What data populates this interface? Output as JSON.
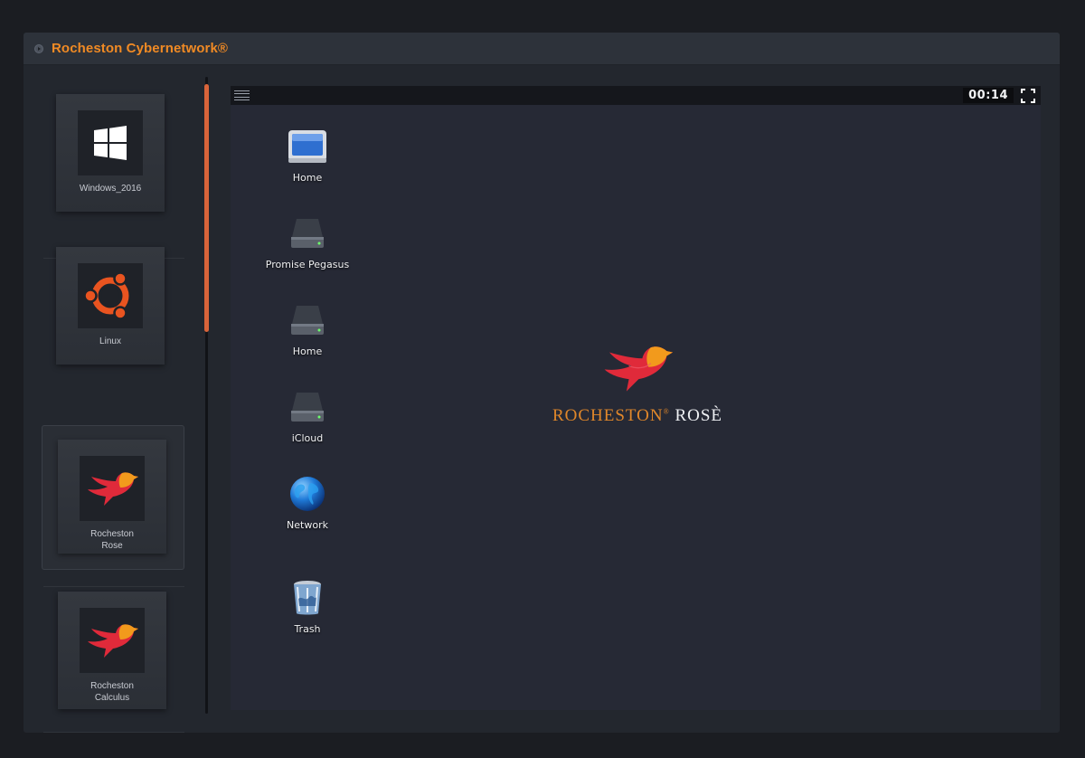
{
  "window": {
    "title": "Rocheston Cybernetwork®"
  },
  "sidebar": {
    "machines": [
      {
        "label": "Windows_2016",
        "icon": "windows-logo-icon"
      },
      {
        "label": "Linux",
        "icon": "ubuntu-logo-icon"
      },
      {
        "label": "Rocheston\nRose",
        "icon": "rocheston-bird-icon",
        "selected": true
      },
      {
        "label": "Rocheston\nCalculus",
        "icon": "rocheston-bird-icon"
      }
    ]
  },
  "viewer": {
    "timer": "00:14",
    "desktop_icons": [
      {
        "label": "Home",
        "icon": "computer-icon"
      },
      {
        "label": "Promise Pegasus",
        "icon": "hard-drive-icon"
      },
      {
        "label": "Home",
        "icon": "hard-drive-icon"
      },
      {
        "label": "iCloud",
        "icon": "hard-drive-icon"
      },
      {
        "label": "Network",
        "icon": "globe-icon"
      },
      {
        "label": "Trash",
        "icon": "trash-icon"
      }
    ],
    "branding": {
      "name_part1": "ROCHESTON",
      "registered": "®",
      "name_part2": "ROSÈ"
    }
  },
  "colors": {
    "accent": "#f08a24",
    "scroll_thumb": "#d9643a",
    "bird_red": "#e0273a",
    "bird_orange": "#f29a1c"
  }
}
